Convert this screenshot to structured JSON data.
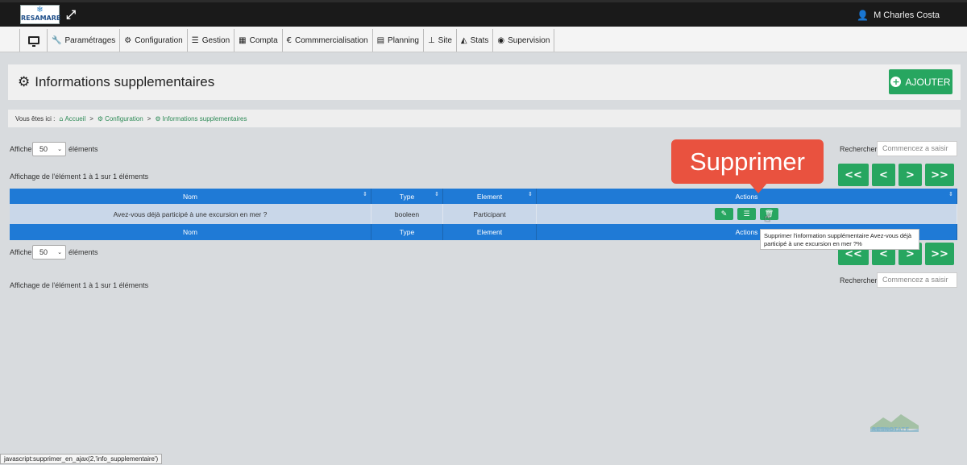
{
  "topbar": {
    "logo_text": "RESAMARE",
    "user_name": "M Charles Costa"
  },
  "menu": {
    "items": [
      {
        "label": "Paramétrages",
        "icon": "wrench-icon"
      },
      {
        "label": "Configuration",
        "icon": "cogs-icon"
      },
      {
        "label": "Gestion",
        "icon": "list-icon"
      },
      {
        "label": "Compta",
        "icon": "calculator-icon"
      },
      {
        "label": "Commmercialisation",
        "icon": "euro-icon"
      },
      {
        "label": "Planning",
        "icon": "calendar-icon"
      },
      {
        "label": "Site",
        "icon": "sitemap-icon"
      },
      {
        "label": "Stats",
        "icon": "area-chart-icon"
      },
      {
        "label": "Supervision",
        "icon": "eye-icon"
      }
    ]
  },
  "page": {
    "title": "Informations supplementaires",
    "add_button": "AJOUTER"
  },
  "breadcrumb": {
    "prefix": "Vous êtes ici :",
    "items": [
      "Accueil",
      "Configuration",
      "Informations supplementaires"
    ],
    "separator": ">"
  },
  "controls": {
    "show_label": "Afficher",
    "page_size": "50",
    "elements_label": "éléments",
    "search_label": "Rechercher :",
    "search_placeholder": "Commencez a saisir",
    "info_text": "Affichage de l'élément 1 à 1 sur 1 éléments"
  },
  "pager": {
    "first": "<<",
    "prev": "<",
    "next": ">",
    "last": ">>"
  },
  "table": {
    "headers": [
      "Nom",
      "Type",
      "Element",
      "Actions"
    ],
    "rows": [
      {
        "nom": "Avez-vous déjà participé à une excursion en mer ?",
        "type": "booleen",
        "element": "Participant"
      }
    ]
  },
  "tooltip": {
    "text": "Supprimer l'information supplémentaire Avez-vous déjà participé à une excursion en mer ?%"
  },
  "callout": {
    "text": "Supprimer"
  },
  "watermark": {
    "text": "RESNOTATE"
  },
  "statusbar": {
    "text": "javascript:supprimer_en_ajax(2,'info_supplementaire')"
  },
  "colors": {
    "accent_green": "#27a660",
    "table_blue": "#1f7ad6",
    "callout_red": "#e9523f"
  }
}
